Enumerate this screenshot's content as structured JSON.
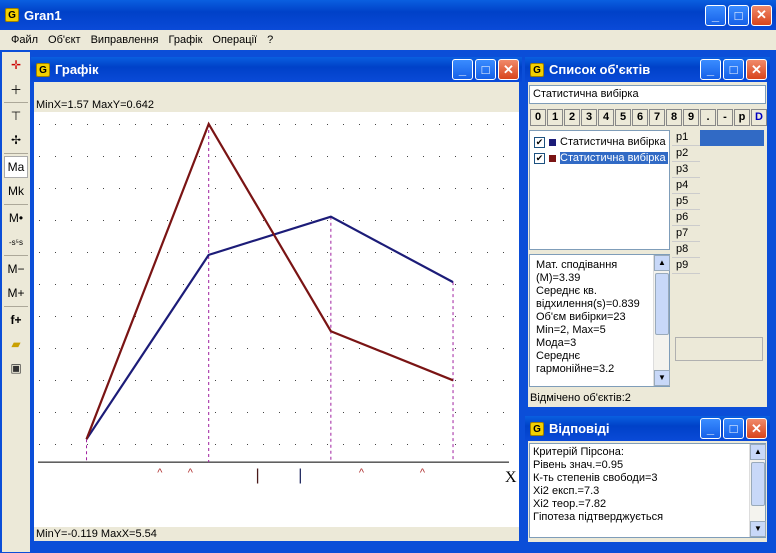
{
  "app": {
    "title": "Gran1",
    "icon_letter": "G"
  },
  "menu": [
    "Файл",
    "Об'єкт",
    "Виправлення",
    "Графік",
    "Операції",
    "?"
  ],
  "toolbar": {
    "icons": [
      "axis-red-icon",
      "crosshair-icon",
      "axis-t-icon",
      "axis-diag-icon",
      "ma-icon",
      "mk-icon",
      "m-dot-icon",
      "stats-icon",
      "m-minus-icon",
      "m-plus-icon",
      "f-plus-icon",
      "open-folder-icon",
      "save-icon"
    ],
    "labels": {
      "ma": "Ma",
      "mk": "Mk",
      "mdot": "M•",
      "fplus": "f+",
      "mminus": "M−",
      "mplus": "M+"
    }
  },
  "graph_window": {
    "title": "Графік",
    "top_label": "MinX=1.57  MaxY=0.642",
    "bottom_label": "MinY=-0.119  MaxX=5.54",
    "axis_x_label": "X",
    "marks": [
      "^",
      "^",
      "|",
      "|",
      "^",
      "^"
    ]
  },
  "chart_data": {
    "type": "line",
    "x": [
      2,
      3,
      4,
      5
    ],
    "series": [
      {
        "values": [
          0.042,
          0.38,
          0.45,
          0.33
        ],
        "color": "#1c1c78"
      },
      {
        "values": [
          0.042,
          0.62,
          0.24,
          0.15
        ],
        "color": "#7a1414"
      }
    ],
    "xlim": [
      1.57,
      5.54
    ],
    "ylim": [
      -0.119,
      0.642
    ],
    "grid": true
  },
  "objects_window": {
    "title": "Список об'єктів",
    "input_value": "Статистична вибірка",
    "digit_buttons": [
      "0",
      "1",
      "2",
      "3",
      "4",
      "5",
      "6",
      "7",
      "8",
      "9",
      ".",
      "-",
      "p",
      "D"
    ],
    "objects": [
      {
        "label": "Статистична вибірка",
        "checked": "✔",
        "color": "#1c1c78"
      },
      {
        "label": "Статистична вибірка",
        "checked": "✔",
        "color": "#7a1414"
      }
    ],
    "params": [
      "p1",
      "p2",
      "p3",
      "p4",
      "p5",
      "p6",
      "p7",
      "p8",
      "p9"
    ],
    "stats_lines": [
      "Мат. сподівання",
      "(M)=3.39",
      "Середнє кв.",
      "відхилення(s)=0.839",
      "Об'єм вибірки=23",
      "Min=2, Max=5",
      "Мода=3",
      "Середнє",
      "гармонійне=3.2"
    ],
    "status": "Відмічено об'єктів:2"
  },
  "answers_window": {
    "title": "Відповіді",
    "lines": [
      "Критерій Пірсона:",
      "Рівень знач.=0.95",
      "К-ть степенів свободи=3",
      "Хі2 експ.=7.3",
      "Хі2 теор.=7.82",
      "Гіпотеза підтверджується"
    ]
  }
}
